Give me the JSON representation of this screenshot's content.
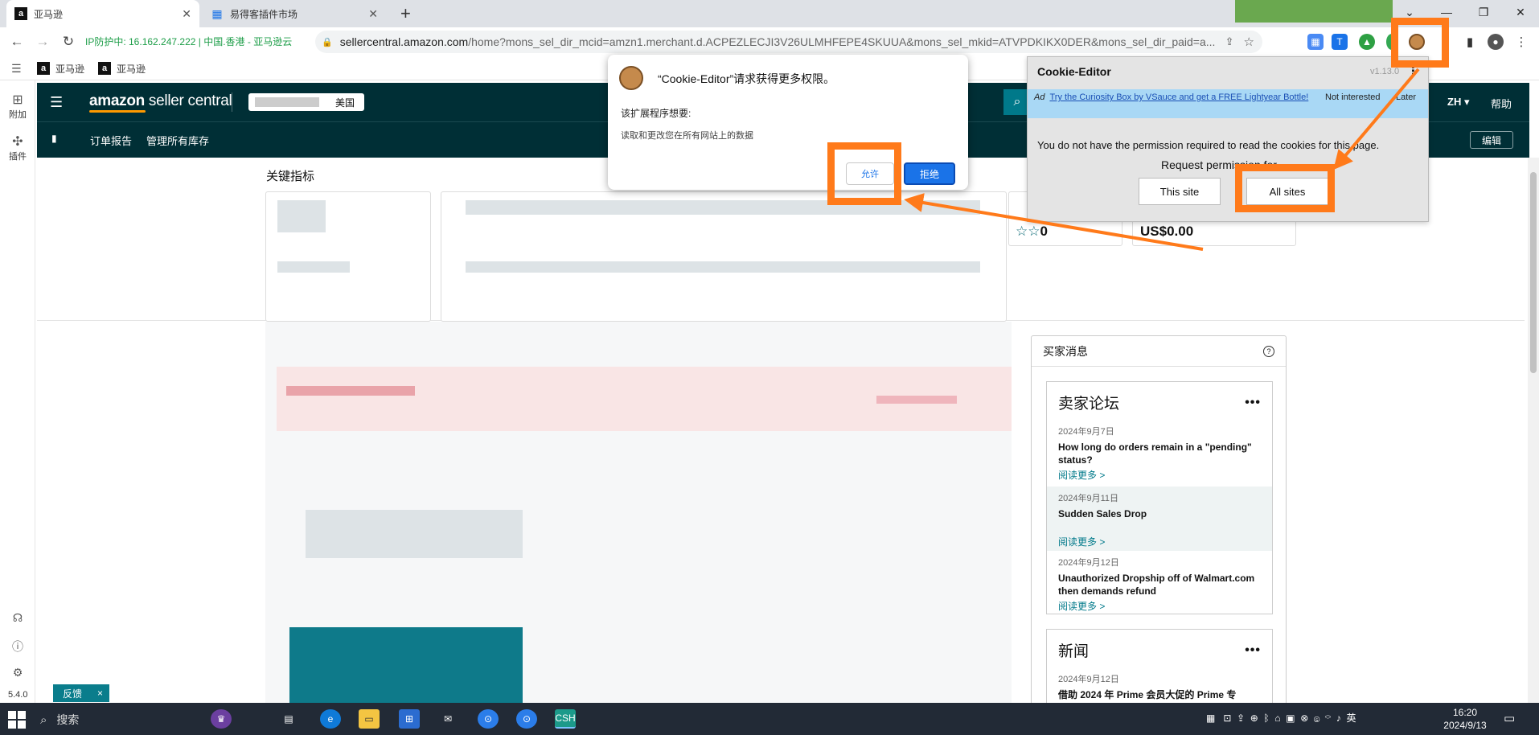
{
  "tabs": [
    {
      "title": "亚马逊",
      "icon": "amazon-icon",
      "active": true
    },
    {
      "title": "易得客插件市场",
      "icon": "grid-icon",
      "active": false
    }
  ],
  "toolbar": {
    "ip_label": "IP防护中: 16.162.247.222 | 中国.香港 - 亚马逊云",
    "url_host": "sellercentral.amazon.com",
    "url_path": "/home?mons_sel_dir_mcid=amzn1.merchant.d.ACPEZLECJI3V26ULMHFEPE4SKUUA&mons_sel_mkid=ATVPDKIKX0DER&mons_sel_dir_paid=a..."
  },
  "bookmarks": [
    {
      "label": "亚马逊"
    },
    {
      "label": "亚马逊"
    }
  ],
  "left_sidebar": {
    "items": [
      {
        "label": "附加",
        "icon": "addon-icon"
      },
      {
        "label": "插件",
        "icon": "plugin-icon"
      }
    ]
  },
  "amazon_header": {
    "logo_amazon": "amazon",
    "logo_rest": " seller central",
    "marketplace": "美国",
    "lang": "ZH",
    "help": "帮助"
  },
  "amazon_nav": {
    "links": [
      "订单报告",
      "管理所有库存"
    ],
    "edit": "编辑"
  },
  "main": {
    "kpi_title": "关键指标",
    "rating_value": "0",
    "balance": "US$0.00"
  },
  "buyer_messages": {
    "title": "买家消息",
    "forum_title": "卖家论坛",
    "forum_items": [
      {
        "date": "2024年9月7日",
        "title": "How long do orders remain in a \"pending\" status?",
        "more": "阅读更多 >"
      },
      {
        "date": "2024年9月11日",
        "title": "Sudden Sales Drop",
        "more": "阅读更多 >"
      },
      {
        "date": "2024年9月12日",
        "title": "Unauthorized Dropship off of Walmart.com then demands refund",
        "more": "阅读更多 >"
      }
    ],
    "news_title": "新闻",
    "news_items": [
      {
        "date": "2024年9月12日",
        "title": "借助 2024 年 Prime 会员大促的 Prime 专"
      }
    ]
  },
  "permission_dialog": {
    "title": "“Cookie-Editor”请求获得更多权限。",
    "subtitle": "该扩展程序想要:",
    "item": "读取和更改您在所有网站上的数据",
    "allow": "允许",
    "deny": "拒绝"
  },
  "cookie_editor": {
    "title": "Cookie-Editor",
    "version": "v1.13.0",
    "ad_label": "Ad",
    "ad_text": "Try the Curiosity Box by VSauce and get a FREE Lightyear Bottle!",
    "not_interested": "Not interested",
    "later": "Later",
    "message": "You do not have the permission required to read the cookies for this page.",
    "request": "Request permission for",
    "this_site": "This site",
    "all_sites": "All sites"
  },
  "feedback": {
    "label": "反馈",
    "close": "×"
  },
  "version": "5.4.0",
  "taskbar": {
    "search": "搜索",
    "tray_lang": "英",
    "time": "16:20",
    "date": "2024/9/13"
  },
  "colors": {
    "amazon_header": "#002f36",
    "highlight": "#ff7a1a",
    "teal_link": "#00798a",
    "chrome_blue": "#1a73e8"
  }
}
